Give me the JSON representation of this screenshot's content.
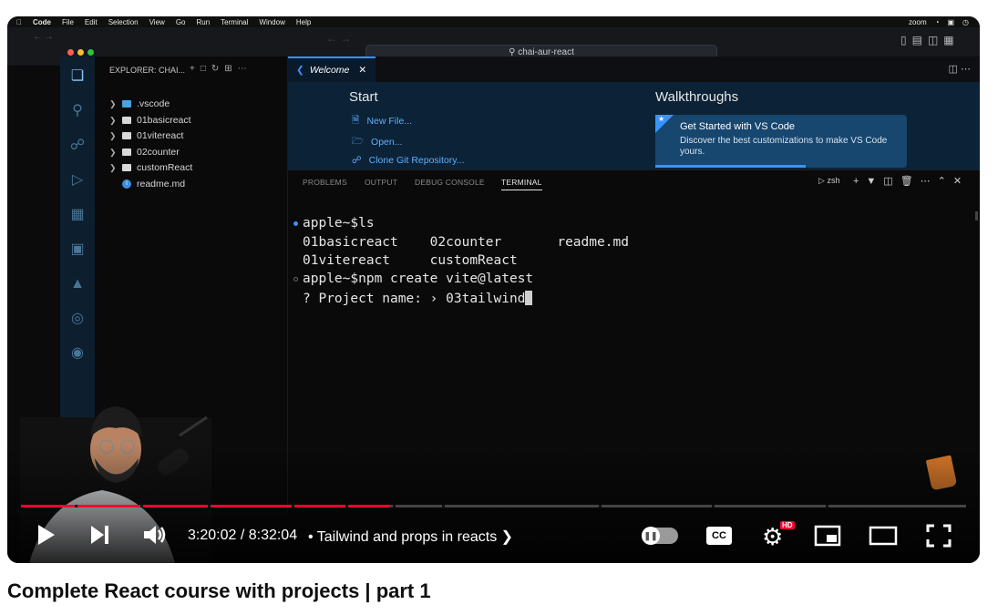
{
  "menubar": {
    "items": [
      "Code",
      "File",
      "Edit",
      "Selection",
      "View",
      "Go",
      "Run",
      "Terminal",
      "Window",
      "Help"
    ],
    "right_text": "zoom"
  },
  "vscode": {
    "search_text": "chai-aur-react",
    "explorer_title": "EXPLORER: CHAI...",
    "tree": [
      ".vscode",
      "01basicreact",
      "01vitereact",
      "02counter",
      "customReact",
      "readme.md"
    ],
    "tab_welcome": "Welcome",
    "start_heading": "Start",
    "start_links": [
      "New File...",
      "Open...",
      "Clone Git Repository..."
    ],
    "walk_heading": "Walkthroughs",
    "walk_card_title": "Get Started with VS Code",
    "walk_card_desc": "Discover the best customizations to make VS Code yours.",
    "panel_tabs": [
      "PROBLEMS",
      "OUTPUT",
      "DEBUG CONSOLE",
      "TERMINAL"
    ],
    "shell": "zsh"
  },
  "terminal": {
    "lines": [
      "apple~$ls",
      "01basicreact    02counter       readme.md",
      "01vitereact     customReact",
      "apple~$npm create vite@latest",
      "? Project name: › 03tailwind"
    ]
  },
  "player": {
    "time": "3:20:02 / 8:32:04",
    "chapter": "Tailwind and props in reacts",
    "progress": 0.39,
    "cc_label": "CC",
    "hd_badge": "HD"
  },
  "video_title": "Complete React course with projects | part 1",
  "colors": {
    "progress": "#ff0033",
    "accent": "#3794ff"
  }
}
